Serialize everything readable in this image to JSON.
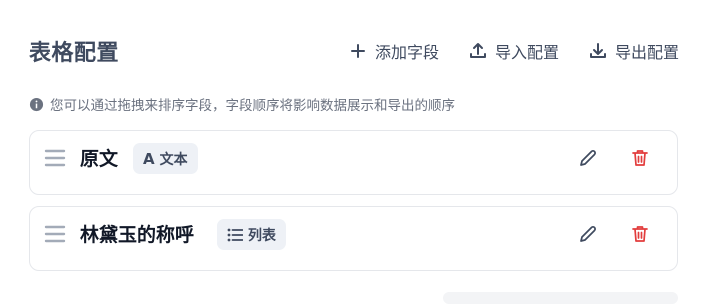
{
  "header": {
    "title": "表格配置",
    "actions": [
      {
        "label": "添加字段",
        "icon": "plus-icon"
      },
      {
        "label": "导入配置",
        "icon": "upload-icon"
      },
      {
        "label": "导出配置",
        "icon": "download-icon"
      }
    ]
  },
  "hint": {
    "icon": "info-icon",
    "text": "您可以通过拖拽来排序字段，字段顺序将影响数据展示和导出的顺序"
  },
  "fields": [
    {
      "name": "原文",
      "type_label": "文本",
      "type_icon": "A"
    },
    {
      "name": "林黛玉的称呼",
      "type_label": "列表",
      "type_icon": "list-icon"
    }
  ],
  "colors": {
    "text_primary": "#3f4a5f",
    "danger": "#e23d3d",
    "badge_bg": "#eef1f6"
  }
}
